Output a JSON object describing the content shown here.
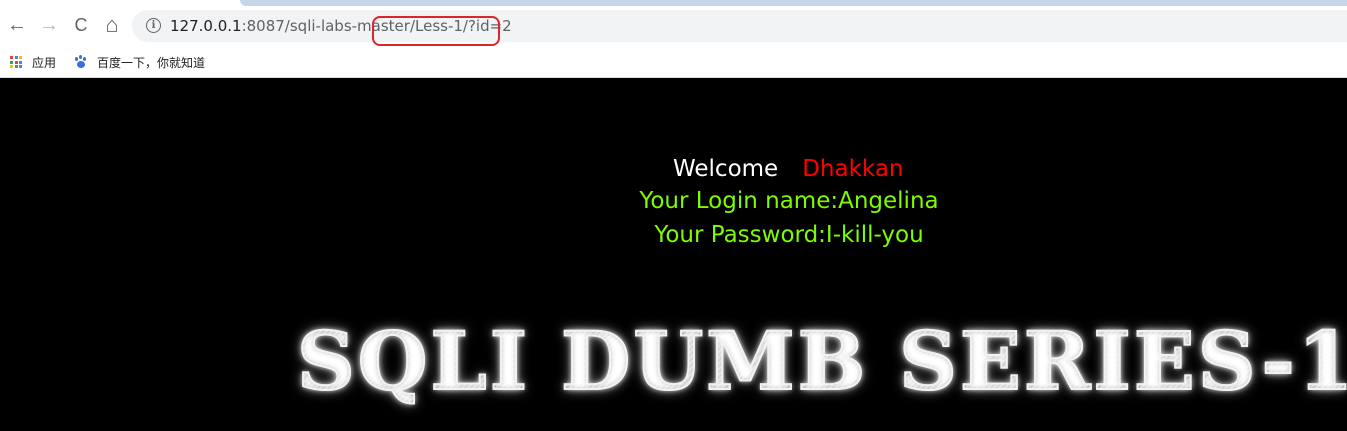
{
  "browser": {
    "url": {
      "host": "127.0.0.1",
      "rest": ":8087/sqli-labs-master/Less-1/?id=2"
    },
    "nav": {
      "back": "←",
      "forward": "→",
      "reload": "C",
      "home": "⌂"
    },
    "info_icon": "i"
  },
  "bookmarks": [
    {
      "label": "应用",
      "icon": "apps-icon"
    },
    {
      "label": "百度一下，你就知道",
      "icon": "baidu-paw-icon"
    }
  ],
  "page": {
    "welcome_label": "Welcome",
    "welcome_name": "Dhakkan",
    "login_line": "Your Login name:Angelina",
    "password_line": "Your Password:I-kill-you",
    "title": "SQLI DUMB SERIES-1"
  },
  "colors": {
    "welcome_name": "#ff0000",
    "credentials": "#7cfc00",
    "page_bg": "#000000",
    "highlight_box": "#d9262a"
  }
}
